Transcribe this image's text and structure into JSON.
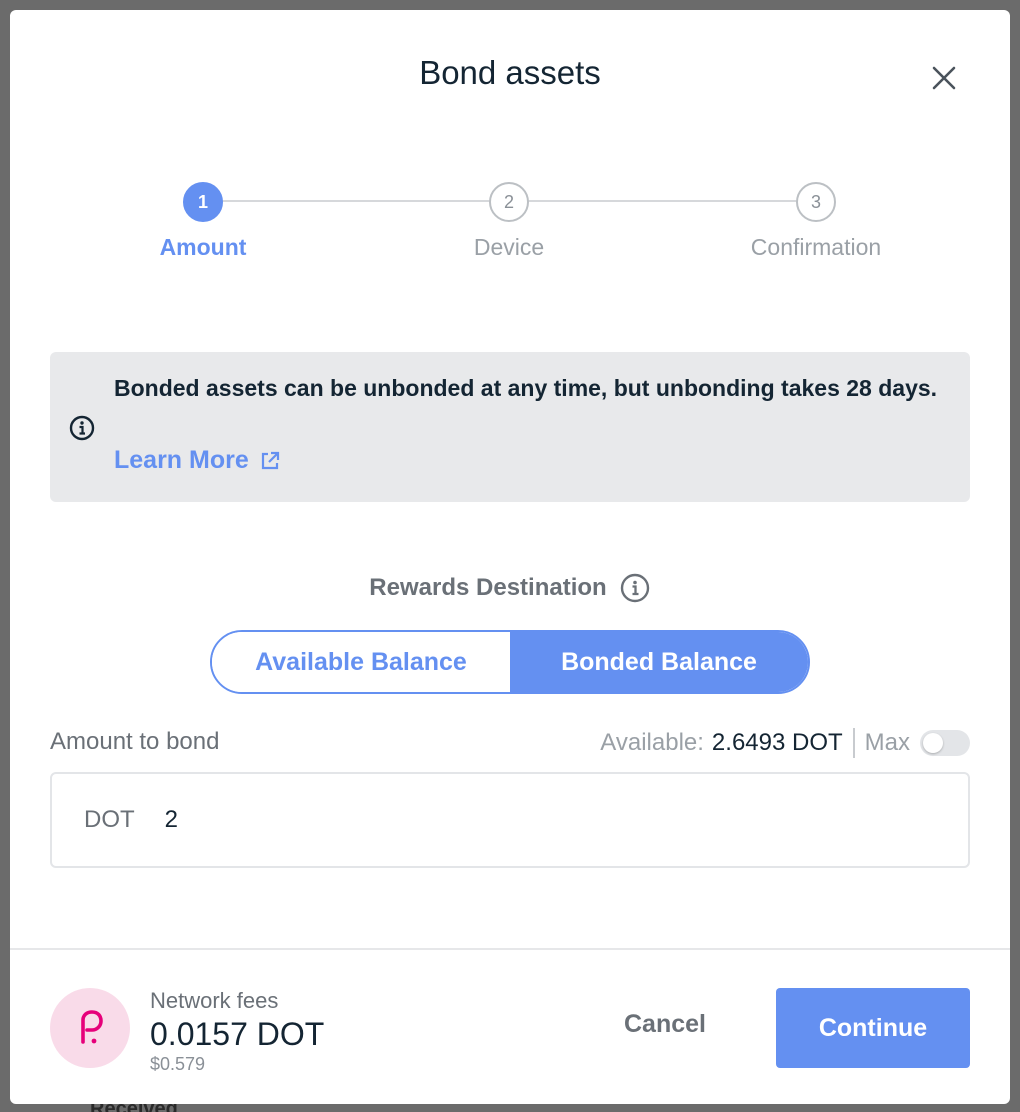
{
  "backdrop": {
    "peek_text": "Received"
  },
  "modal": {
    "title": "Bond assets",
    "close_icon": "close-icon"
  },
  "stepper": {
    "steps": [
      {
        "number": "1",
        "label": "Amount",
        "active": true
      },
      {
        "number": "2",
        "label": "Device",
        "active": false
      },
      {
        "number": "3",
        "label": "Confirmation",
        "active": false
      }
    ]
  },
  "info": {
    "text": "Bonded assets can be unbonded at any time, but unbonding takes 28 days.",
    "link_label": "Learn More",
    "icon": "info-icon",
    "link_icon": "external-link-icon"
  },
  "rewards": {
    "label": "Rewards Destination",
    "options": [
      "Available Balance",
      "Bonded Balance"
    ],
    "selected": "Bonded Balance"
  },
  "amount": {
    "label": "Amount to bond",
    "available_key": "Available:",
    "available_value": "2.6493 DOT",
    "max_label": "Max",
    "max_enabled": false,
    "unit": "DOT",
    "value": "2"
  },
  "footer": {
    "fee_label": "Network fees",
    "fee_value": "0.0157 DOT",
    "fee_fiat": "$0.579",
    "coin_icon": "polkadot-icon",
    "cancel_label": "Cancel",
    "continue_label": "Continue"
  },
  "colors": {
    "accent": "#6490f1",
    "coin_bg": "#f9dbe9",
    "coin_fg": "#e6007a"
  }
}
